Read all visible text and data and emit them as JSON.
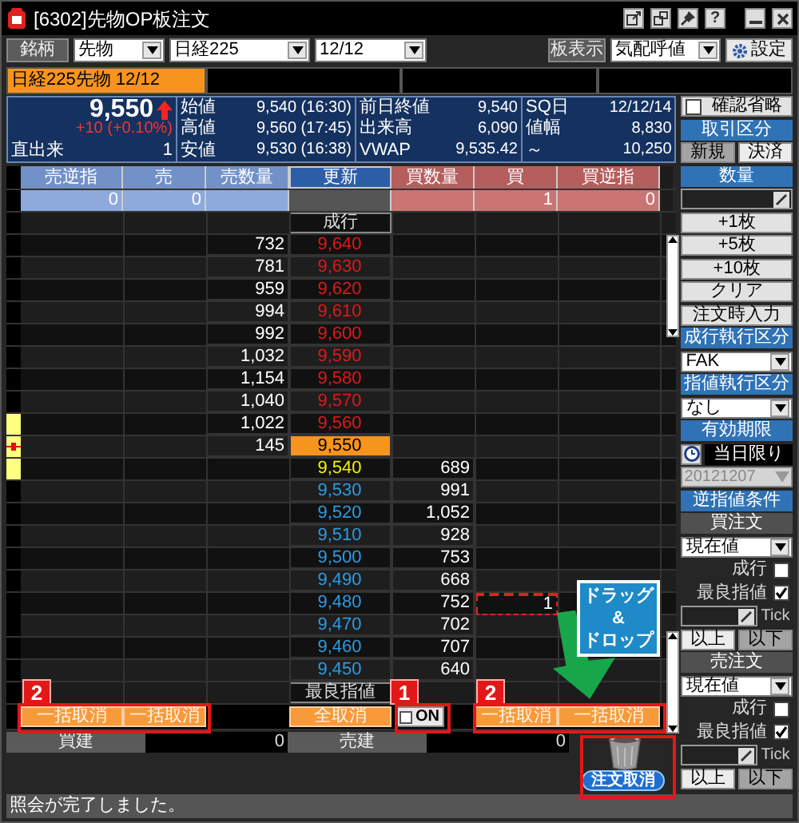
{
  "window": {
    "title": "[6302]先物OP板注文",
    "help_button": "?"
  },
  "toolbar": {
    "symbol_button": "銘柄",
    "product": "先物",
    "index": "日経225",
    "month": "12/12",
    "board_button": "板表示",
    "display_mode": "気配呼値",
    "settings_button": "設定"
  },
  "tabs": [
    {
      "label": "日経225先物 12/12",
      "selected": true
    }
  ],
  "quote": {
    "last": "9,550",
    "change": "+10 (+0.10%)",
    "volume_label": "直出来",
    "volume": "1",
    "columns": [
      [
        {
          "label": "始値",
          "value": "9,540 (16:30)"
        },
        {
          "label": "高値",
          "value": "9,560 (17:45)"
        },
        {
          "label": "安値",
          "value": "9,530 (16:38)"
        }
      ],
      [
        {
          "label": "前日終値",
          "value": "9,540"
        },
        {
          "label": "出来高",
          "value": "6,090"
        },
        {
          "label": "VWAP",
          "value": "9,535.42"
        }
      ],
      [
        {
          "label": "SQ日",
          "value": "12/12/14"
        },
        {
          "label": "値幅",
          "value": "8,830"
        },
        {
          "label": "～",
          "value": "10,250"
        }
      ]
    ]
  },
  "board": {
    "columns": [
      "売逆指",
      "売",
      "売数量",
      "更新",
      "買数量",
      "買",
      "買逆指"
    ],
    "totals": {
      "sell_stop": "0",
      "sell": "0",
      "buy": "1",
      "buy_stop": "0"
    },
    "market_label": "成行",
    "rows": [
      {
        "price": "9,640",
        "kind": "ask",
        "qty": "732",
        "order_marked": false
      },
      {
        "price": "9,630",
        "kind": "ask",
        "qty": "781",
        "order_marked": false
      },
      {
        "price": "9,620",
        "kind": "ask",
        "qty": "959",
        "order_marked": false
      },
      {
        "price": "9,610",
        "kind": "ask",
        "qty": "994",
        "order_marked": false
      },
      {
        "price": "9,600",
        "kind": "ask",
        "qty": "992",
        "order_marked": false
      },
      {
        "price": "9,590",
        "kind": "ask",
        "qty": "1,032",
        "order_marked": false
      },
      {
        "price": "9,580",
        "kind": "ask",
        "qty": "1,154",
        "order_marked": false
      },
      {
        "price": "9,570",
        "kind": "ask",
        "qty": "1,040",
        "order_marked": false
      },
      {
        "price": "9,560",
        "kind": "ask",
        "qty": "1,022",
        "order_marked": false
      },
      {
        "price": "9,550",
        "kind": "last",
        "qty": "145",
        "order_marked": false
      },
      {
        "price": "9,540",
        "kind": "best_bid",
        "qty": "689",
        "order_marked": false
      },
      {
        "price": "9,530",
        "kind": "bid",
        "qty": "991",
        "order_marked": false
      },
      {
        "price": "9,520",
        "kind": "bid",
        "qty": "1,052",
        "order_marked": false
      },
      {
        "price": "9,510",
        "kind": "bid",
        "qty": "928",
        "order_marked": false
      },
      {
        "price": "9,500",
        "kind": "bid",
        "qty": "753",
        "order_marked": false
      },
      {
        "price": "9,490",
        "kind": "bid",
        "qty": "668",
        "order_marked": false
      },
      {
        "price": "9,480",
        "kind": "bid",
        "qty": "752",
        "buy_order": "1",
        "order_marked": true
      },
      {
        "price": "9,470",
        "kind": "bid",
        "qty": "702",
        "order_marked": false
      },
      {
        "price": "9,460",
        "kind": "bid",
        "qty": "707",
        "order_marked": false
      },
      {
        "price": "9,450",
        "kind": "bid",
        "qty": "640",
        "order_marked": false
      }
    ],
    "best_limit_label": "最良指値",
    "sell_bulk_cancel": [
      "一括取消",
      "一括取消"
    ],
    "cancel_all": "全取消",
    "on_toggle": {
      "label": "ON",
      "checked": false
    },
    "buy_bulk_cancel": [
      "一括取消",
      "一括取消"
    ],
    "positions": [
      {
        "label": "買建",
        "value": "0"
      },
      {
        "label": "売建",
        "value": "0"
      }
    ],
    "cancel_order_button": "注文取消"
  },
  "side_panel": [
    {
      "kind": "checkbox",
      "label": "確認省略",
      "checked": false
    },
    {
      "kind": "header",
      "label": "取引区分"
    },
    {
      "kind": "pair",
      "options": [
        {
          "label": "新規",
          "selected": true
        },
        {
          "label": "決済",
          "selected": false
        }
      ]
    },
    {
      "kind": "header",
      "label": "数量"
    },
    {
      "kind": "input"
    },
    {
      "kind": "button",
      "label": "+1枚"
    },
    {
      "kind": "button",
      "label": "+5枚"
    },
    {
      "kind": "button",
      "label": "+10枚"
    },
    {
      "kind": "button",
      "label": "クリア"
    },
    {
      "kind": "button",
      "label": "注文時入力"
    },
    {
      "kind": "header",
      "label": "成行執行区分"
    },
    {
      "kind": "select",
      "value": "FAK"
    },
    {
      "kind": "header",
      "label": "指値執行区分"
    },
    {
      "kind": "select",
      "value": "なし"
    },
    {
      "kind": "header",
      "label": "有効期限"
    },
    {
      "kind": "expiry",
      "value": "当日限り"
    },
    {
      "kind": "date",
      "value": "20121207",
      "disabled": true
    },
    {
      "kind": "header",
      "label": "逆指値条件"
    },
    {
      "kind": "subheader",
      "label": "買注文"
    },
    {
      "kind": "select",
      "value": "現在値"
    },
    {
      "kind": "check",
      "label": "成行",
      "checked": false
    },
    {
      "kind": "check",
      "label": "最良指値",
      "checked": true
    },
    {
      "kind": "tick",
      "label": "Tick"
    },
    {
      "kind": "pair",
      "options": [
        {
          "label": "以上",
          "selected": false
        },
        {
          "label": "以下",
          "selected": true
        }
      ]
    },
    {
      "kind": "subheader",
      "label": "売注文"
    },
    {
      "kind": "select",
      "value": "現在値"
    },
    {
      "kind": "check",
      "label": "成行",
      "checked": false
    },
    {
      "kind": "check",
      "label": "最良指値",
      "checked": true
    },
    {
      "kind": "tick",
      "label": "Tick"
    },
    {
      "kind": "pair",
      "options": [
        {
          "label": "以上",
          "selected": false
        },
        {
          "label": "以下",
          "selected": true
        }
      ]
    }
  ],
  "status_bar": "照会が完了しました。",
  "annotations": {
    "badges": [
      "2",
      "1",
      "2"
    ],
    "callout": "ドラッグ\n&\nドロップ"
  }
}
